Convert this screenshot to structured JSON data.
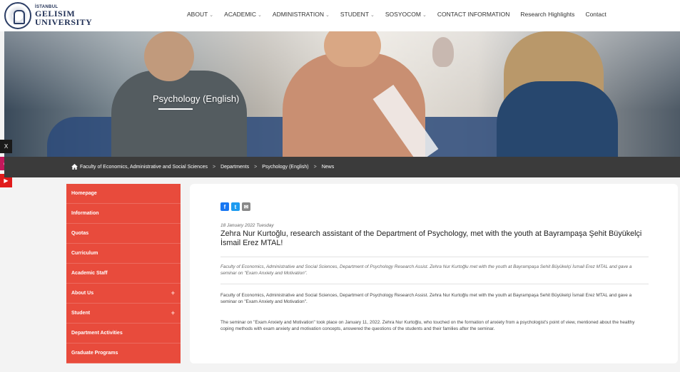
{
  "header": {
    "logo_small": "İSTANBUL",
    "logo_line1": "GELISIM",
    "logo_line2": "UNIVERSITY",
    "nav": [
      {
        "label": "ABOUT",
        "dropdown": true
      },
      {
        "label": "ACADEMIC",
        "dropdown": true
      },
      {
        "label": "ADMINISTRATION",
        "dropdown": true
      },
      {
        "label": "STUDENT",
        "dropdown": true
      },
      {
        "label": "SOSYOCOM",
        "dropdown": true
      },
      {
        "label": "CONTACT INFORMATION",
        "dropdown": false
      },
      {
        "label": "Research Highlights",
        "dropdown": false
      },
      {
        "label": "Contact",
        "dropdown": false
      }
    ]
  },
  "hero": {
    "title": "Psychology (English)"
  },
  "breadcrumb": {
    "items": [
      "Faculty of Economics, Administrative and Social Sciences",
      "Departments",
      "Psychology (English)",
      "News"
    ],
    "separator": ">"
  },
  "social": {
    "x": "X",
    "instagram": "◎",
    "youtube": "▶"
  },
  "sidebar": {
    "items": [
      {
        "label": "Homepage",
        "expandable": false
      },
      {
        "label": "Information",
        "expandable": false
      },
      {
        "label": "Quotas",
        "expandable": false
      },
      {
        "label": "Curriculum",
        "expandable": false
      },
      {
        "label": "Academic Staff",
        "expandable": false
      },
      {
        "label": "About Us",
        "expandable": true
      },
      {
        "label": "Student",
        "expandable": true
      },
      {
        "label": "Department Activities",
        "expandable": false
      },
      {
        "label": "Graduate Programs",
        "expandable": false
      }
    ],
    "plus_symbol": "+"
  },
  "article": {
    "share": {
      "facebook": "f",
      "twitter": "t",
      "email": "✉"
    },
    "date": "18 January 2022 Tuesday",
    "headline": " Zehra Nur Kurtoğlu, research assistant of the Department of Psychology, met with the youth at Bayrampaşa Şehit Büyükelçi İsmail Erez MTAL!",
    "summary": "Faculty of Economics, Administrative and Social Sciences, Department of Psychology Research Assist. Zehra Nur Kurtoğlu met with the youth at Bayrampaşa Sehit Büyükelçi İsmail Erez MTAL and gave a seminar on \"Exam Anxiety and Motivation\".",
    "paragraph1": "Faculty of Economics, Administrative and Social Sciences, Department of Psychology Research Assist. Zehra Nur Kurtoğlu met with the youth at Bayrampaşa Sehit Büyükelçi İsmail Erez MTAL and gave a seminar on \"Exam Anxiety and Motivation\".",
    "paragraph2": "The seminar on \"Exam Anxiety and Motivation\" took place on January 11, 2022. Zehra Nur Kurtoğlu, who touched on the formation of anxiety from a psychologist's point of view, mentioned about the healthy coping methods with exam anxiety and motivation concepts, answered the questions of the students and their families after the seminar."
  },
  "colors": {
    "sidebar_bg": "#e84b3c",
    "breadcrumb_bg": "#3b3b3b",
    "facebook": "#1877f2",
    "twitter": "#1d9bf0"
  }
}
